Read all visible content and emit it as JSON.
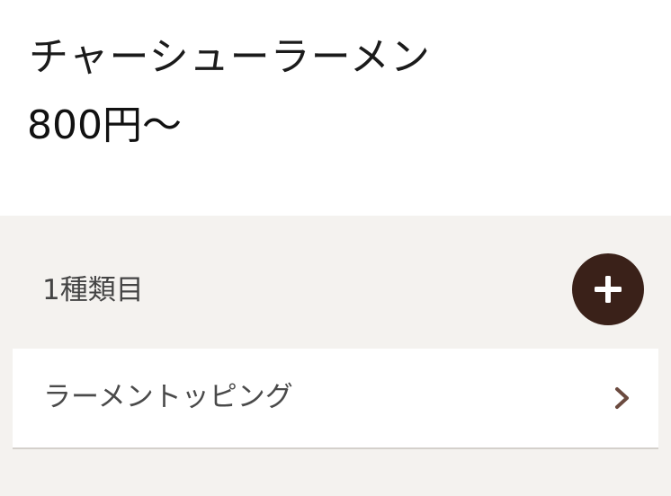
{
  "item": {
    "name": "チャーシューラーメン",
    "price": "800円〜"
  },
  "selection": {
    "label": "1種類目",
    "add_icon": "plus-icon",
    "add_button_color": "#3a2119"
  },
  "options": [
    {
      "label": "ラーメントッピング",
      "icon": "chevron-right-icon"
    }
  ],
  "colors": {
    "section_background": "#f4f2ef",
    "chevron": "#6b4a3f"
  }
}
